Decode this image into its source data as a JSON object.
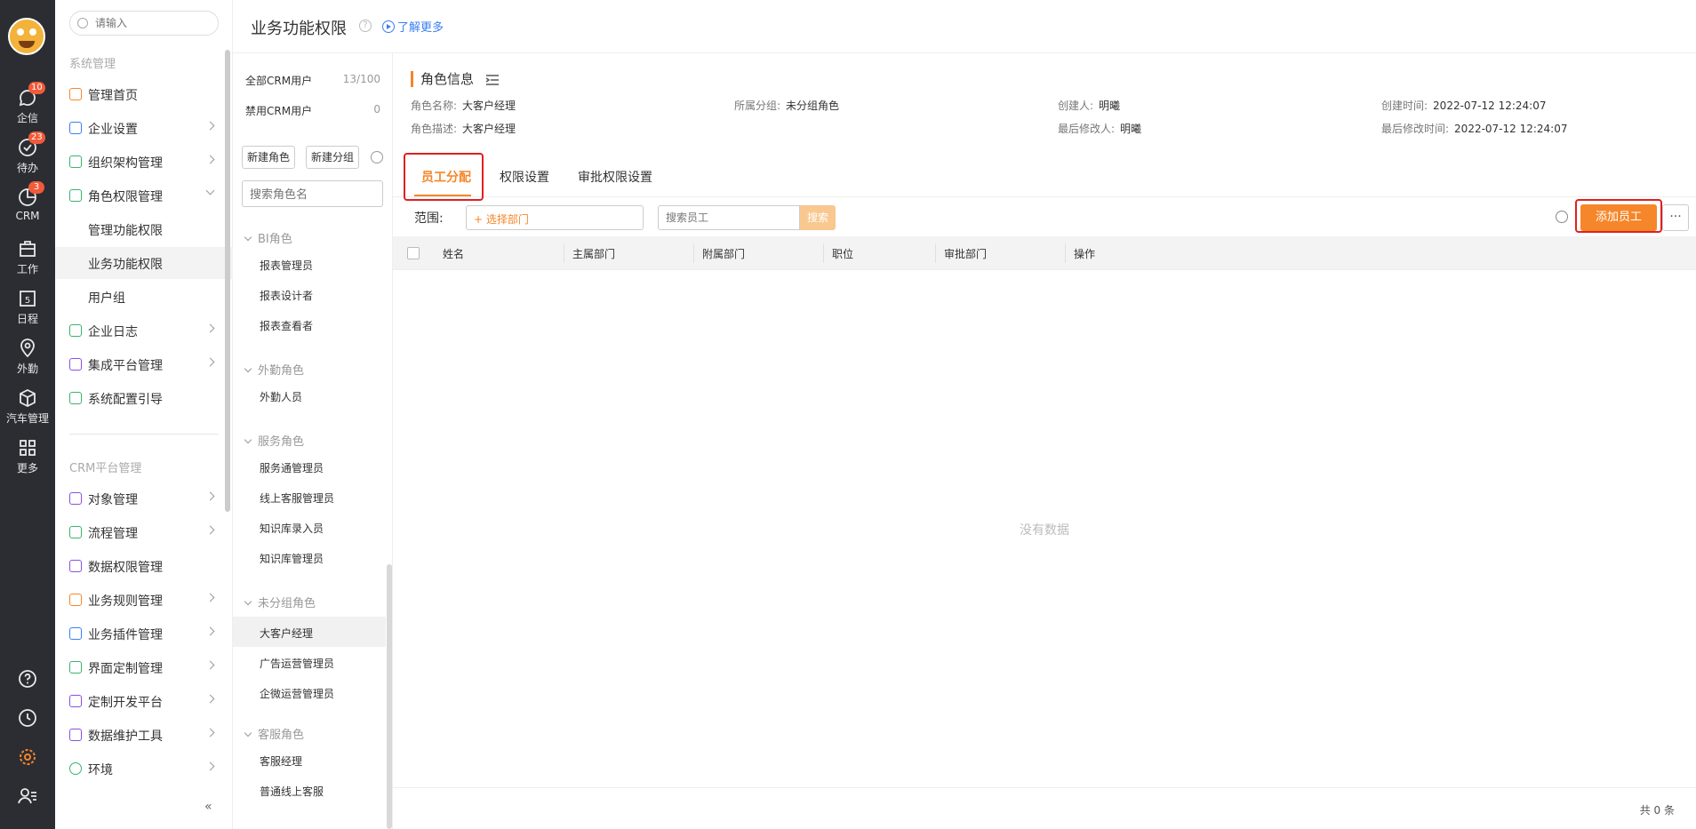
{
  "rail": {
    "items": [
      {
        "label": "企信",
        "badge": "10"
      },
      {
        "label": "待办",
        "badge": "23"
      },
      {
        "label": "CRM",
        "badge": "3"
      },
      {
        "label": "工作",
        "badge": ""
      },
      {
        "label": "日程",
        "badge": ""
      },
      {
        "label": "外勤",
        "badge": ""
      },
      {
        "label": "汽车管理",
        "badge": ""
      },
      {
        "label": "更多",
        "badge": ""
      }
    ],
    "calendar_day": "5",
    "accent": "#f5862a"
  },
  "menu": {
    "search_placeholder": "请输入",
    "section1": "系统管理",
    "section2": "CRM平台管理",
    "items1": [
      "管理首页",
      "企业设置",
      "组织架构管理",
      "角色权限管理",
      "管理功能权限",
      "业务功能权限",
      "用户组",
      "企业日志",
      "集成平台管理",
      "系统配置引导"
    ],
    "items2": [
      "对象管理",
      "流程管理",
      "数据权限管理",
      "业务规则管理",
      "业务插件管理",
      "界面定制管理",
      "定制开发平台",
      "数据维护工具",
      "环境"
    ],
    "collapse": "«"
  },
  "roles": {
    "all_users": "全部CRM用户",
    "all_count": "13/100",
    "disabled_users": "禁用CRM用户",
    "disabled_count": "0",
    "new_role": "新建角色",
    "new_group": "新建分组",
    "search_placeholder": "搜索角色名",
    "groups": [
      {
        "name": "BI角色",
        "items": [
          "报表管理员",
          "报表设计者",
          "报表查看者"
        ]
      },
      {
        "name": "外勤角色",
        "items": [
          "外勤人员"
        ]
      },
      {
        "name": "服务角色",
        "items": [
          "服务通管理员",
          "线上客服管理员",
          "知识库录入员",
          "知识库管理员"
        ]
      },
      {
        "name": "未分组角色",
        "items": [
          "大客户经理",
          "广告运营管理员",
          "企微运营管理员"
        ]
      },
      {
        "name": "客服角色",
        "items": [
          "客服经理",
          "普通线上客服"
        ]
      }
    ]
  },
  "header": {
    "title": "业务功能权限",
    "help": "?",
    "learn_more": "了解更多"
  },
  "info": {
    "title": "角色信息",
    "fields": [
      {
        "k": "角色名称:",
        "v": "大客户经理"
      },
      {
        "k": "所属分组:",
        "v": "未分组角色"
      },
      {
        "k": "创建人:",
        "v": "明曦"
      },
      {
        "k": "创建时间:",
        "v": "2022-07-12 12:24:07"
      },
      {
        "k": "角色描述:",
        "v": "大客户经理"
      },
      {
        "k": "最后修改人:",
        "v": "明曦"
      },
      {
        "k": "最后修改时间:",
        "v": "2022-07-12 12:24:07"
      }
    ]
  },
  "tabs": [
    "员工分配",
    "权限设置",
    "审批权限设置"
  ],
  "filter": {
    "scope_label": "范围:",
    "dept_placeholder": "+ 选择部门",
    "emp_placeholder": "搜索员工",
    "search_btn": "搜索",
    "add_btn": "添加员工",
    "more": "···"
  },
  "table": {
    "columns": [
      "姓名",
      "主属部门",
      "附属部门",
      "职位",
      "审批部门",
      "操作"
    ],
    "empty": "没有数据"
  },
  "footer": {
    "total": "共 0 条"
  }
}
